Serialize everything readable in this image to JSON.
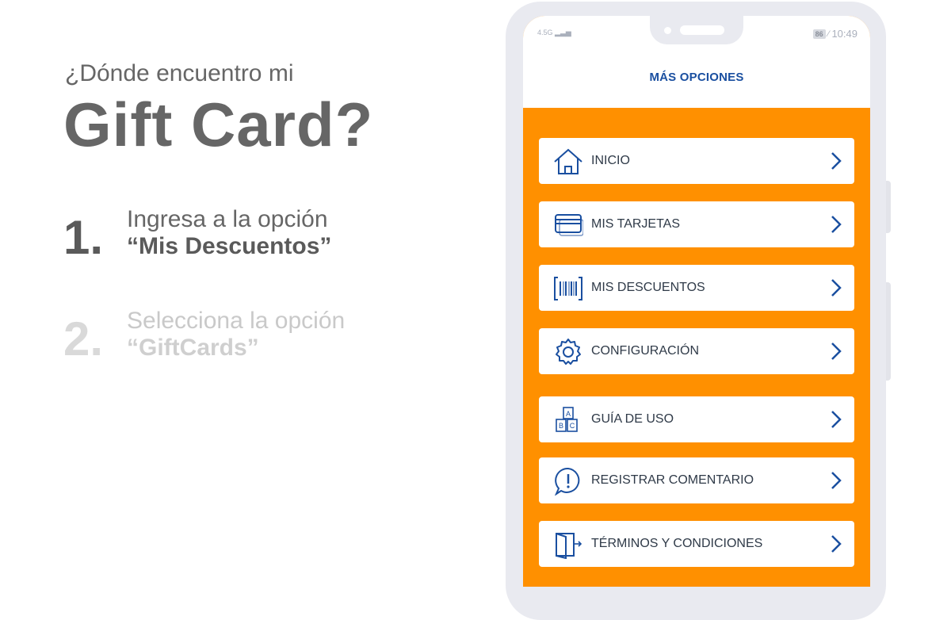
{
  "intro": {
    "question": "¿Dónde encuentro mi",
    "title": "Gift Card?"
  },
  "steps": [
    {
      "number": "1.",
      "line1": "Ingresa a la opción",
      "line2": "“Mis Descuentos”"
    },
    {
      "number": "2.",
      "line1": "Selecciona la opción",
      "line2": "“GiftCards”"
    }
  ],
  "phone": {
    "status_bar": {
      "network": "4.5G",
      "battery": "86",
      "time": "10:49"
    },
    "header_title": "MÁS OPCIONES",
    "menu": [
      {
        "label": "INICIO",
        "icon": "home-icon"
      },
      {
        "label": "MIS TARJETAS",
        "icon": "credit-card-icon"
      },
      {
        "label": "MIS DESCUENTOS",
        "icon": "barcode-icon"
      },
      {
        "label": "CONFIGURACIÓN",
        "icon": "gear-icon"
      },
      {
        "label": "GUÍA DE USO",
        "icon": "abc-blocks-icon"
      },
      {
        "label": "REGISTRAR COMENTARIO",
        "icon": "comment-alert-icon"
      },
      {
        "label": "TÉRMINOS Y CONDICIONES",
        "icon": "exit-door-icon"
      }
    ]
  },
  "colors": {
    "accent_orange": "#ff9000",
    "icon_blue": "#1a4fa0",
    "text_gray": "#666666",
    "faded_gray": "#d0d0d0"
  }
}
